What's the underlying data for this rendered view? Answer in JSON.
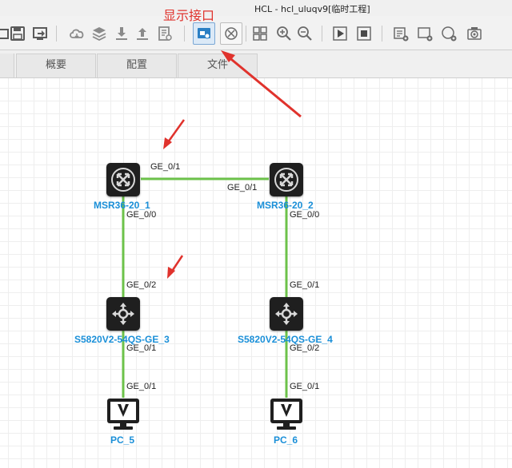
{
  "window": {
    "title": "HCL - hcl_uluqv9[临时工程]"
  },
  "annotation": {
    "label": "显示接口",
    "color": "#e0322c"
  },
  "toolbar": {
    "buttons": [
      {
        "name": "open-project-button",
        "icon": "folder-icon"
      },
      {
        "name": "save-button",
        "icon": "save-icon"
      },
      {
        "name": "import-button",
        "icon": "import-icon"
      },
      {
        "name": "cloud-button",
        "icon": "cloud-icon"
      },
      {
        "name": "layers-button",
        "icon": "layers-icon"
      },
      {
        "name": "download-button",
        "icon": "download-icon"
      },
      {
        "name": "upload-button",
        "icon": "upload-icon"
      },
      {
        "name": "config-doc-button",
        "icon": "document-icon"
      },
      {
        "name": "show-interface-button",
        "icon": "show-interface-icon",
        "active": true
      },
      {
        "name": "topology-button",
        "icon": "topology-icon"
      },
      {
        "name": "grid-button",
        "icon": "grid-icon"
      },
      {
        "name": "zoom-in-button",
        "icon": "zoom-in-icon"
      },
      {
        "name": "zoom-out-button",
        "icon": "zoom-out-icon"
      },
      {
        "name": "start-button",
        "icon": "play-icon"
      },
      {
        "name": "stop-button",
        "icon": "stop-icon"
      },
      {
        "name": "add-note-button",
        "icon": "note-add-icon"
      },
      {
        "name": "add-rect-button",
        "icon": "rect-add-icon"
      },
      {
        "name": "add-ellipse-button",
        "icon": "ellipse-add-icon"
      },
      {
        "name": "screenshot-button",
        "icon": "camera-icon"
      }
    ]
  },
  "tabs": [
    {
      "label": "概要"
    },
    {
      "label": "配置"
    },
    {
      "label": "文件"
    }
  ],
  "colors": {
    "link": "#6cc24a",
    "device_label": "#1a8fd8",
    "device_body": "#1f1f1f"
  },
  "devices": {
    "r1": {
      "name": "MSR36-20_1",
      "type": "router"
    },
    "r2": {
      "name": "MSR36-20_2",
      "type": "router"
    },
    "s3": {
      "name": "S5820V2-54QS-GE_3",
      "type": "switch"
    },
    "s4": {
      "name": "S5820V2-54QS-GE_4",
      "type": "switch"
    },
    "pc5": {
      "name": "PC_5",
      "type": "pc"
    },
    "pc6": {
      "name": "PC_6",
      "type": "pc"
    }
  },
  "ports": {
    "r1_r2_a": "GE_0/1",
    "r1_r2_b": "GE_0/1",
    "r1_s3_a": "GE_0/0",
    "r1_s3_b": "GE_0/2",
    "r2_s4_a": "GE_0/0",
    "r2_s4_b": "GE_0/1",
    "s3_pc5_a": "GE_0/1",
    "s3_pc5_b": "GE_0/1",
    "s4_pc6_a": "GE_0/2",
    "s4_pc6_b": "GE_0/1"
  }
}
